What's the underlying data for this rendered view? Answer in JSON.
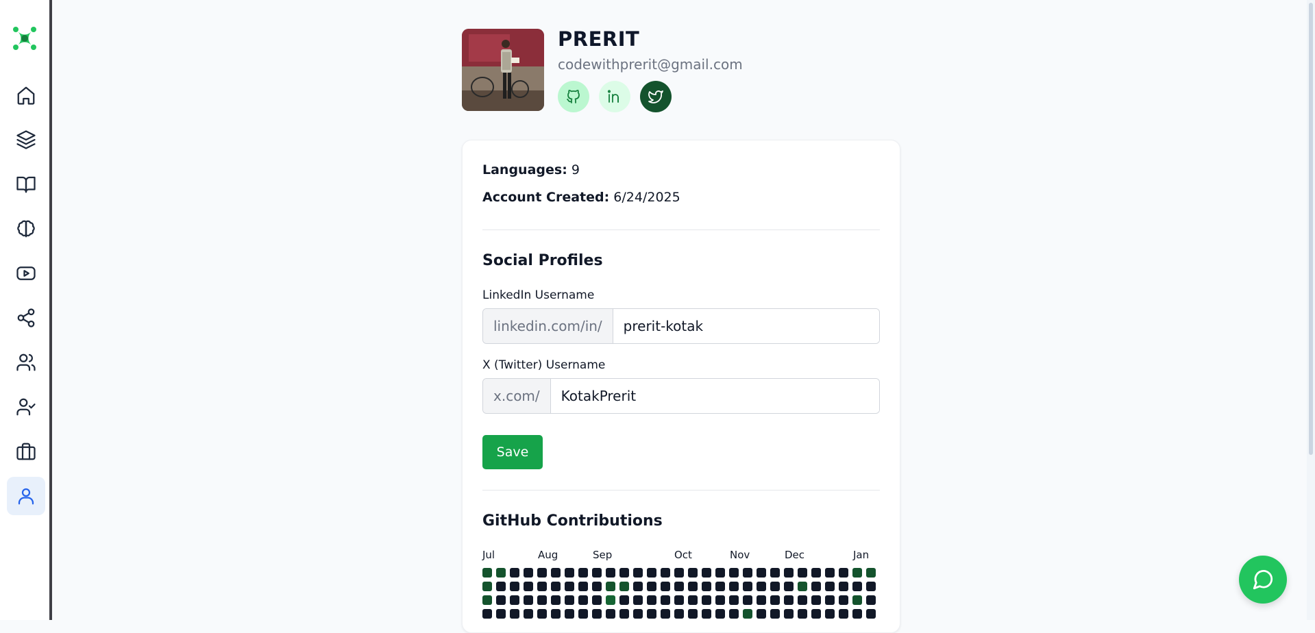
{
  "sidebar": {
    "logo_icon": "app-logo-icon",
    "items": [
      {
        "icon": "home-icon",
        "active": false
      },
      {
        "icon": "layers-icon",
        "active": false
      },
      {
        "icon": "book-open-icon",
        "active": false
      },
      {
        "icon": "brain-icon",
        "active": false
      },
      {
        "icon": "youtube-icon",
        "active": false
      },
      {
        "icon": "share-icon",
        "active": false
      },
      {
        "icon": "users-icon",
        "active": false
      },
      {
        "icon": "user-check-icon",
        "active": false
      },
      {
        "icon": "briefcase-icon",
        "active": false
      },
      {
        "icon": "user-icon",
        "active": true
      }
    ]
  },
  "profile": {
    "name": "PRERIT",
    "email": "codewithprerit@gmail.com",
    "social_links": [
      {
        "icon": "github-icon",
        "bg": "#bbf7d0",
        "color": "#15803d"
      },
      {
        "icon": "linkedin-icon",
        "bg": "#dcfce7",
        "color": "#15803d"
      },
      {
        "icon": "twitter-icon",
        "bg": "#14532d",
        "color": "#ffffff"
      }
    ]
  },
  "stats": {
    "languages_label": "Languages:",
    "languages_value": "9",
    "created_label": "Account Created:",
    "created_value": "6/24/2025"
  },
  "social_profiles": {
    "title": "Social Profiles",
    "linkedin_label": "LinkedIn Username",
    "linkedin_prefix": "linkedin.com/in/",
    "linkedin_value": "prerit-kotak",
    "twitter_label": "X (Twitter) Username",
    "twitter_prefix": "x.com/",
    "twitter_value": "KotakPrerit",
    "save_label": "Save"
  },
  "github": {
    "title": "GitHub Contributions",
    "months": [
      "Jul",
      "Aug",
      "Sep",
      "Oct",
      "Nov",
      "Dec",
      "Jan"
    ],
    "highlight_cells": [
      {
        "week": 0,
        "day": 0,
        "level": 1
      },
      {
        "week": 1,
        "day": 0,
        "level": 1
      },
      {
        "week": 0,
        "day": 1,
        "level": 1
      },
      {
        "week": 9,
        "day": 1,
        "level": 1
      },
      {
        "week": 10,
        "day": 1,
        "level": 1
      },
      {
        "week": 23,
        "day": 1,
        "level": 1
      },
      {
        "week": 0,
        "day": 2,
        "level": 1
      },
      {
        "week": 9,
        "day": 2,
        "level": 2
      },
      {
        "week": 27,
        "day": 2,
        "level": 1
      },
      {
        "week": 19,
        "day": 3,
        "level": 1
      },
      {
        "week": 27,
        "day": 0,
        "level": 1
      },
      {
        "week": 28,
        "day": 0,
        "level": 1
      }
    ]
  },
  "colors": {
    "accent": "#16a34a",
    "active_nav": "#2563eb"
  }
}
